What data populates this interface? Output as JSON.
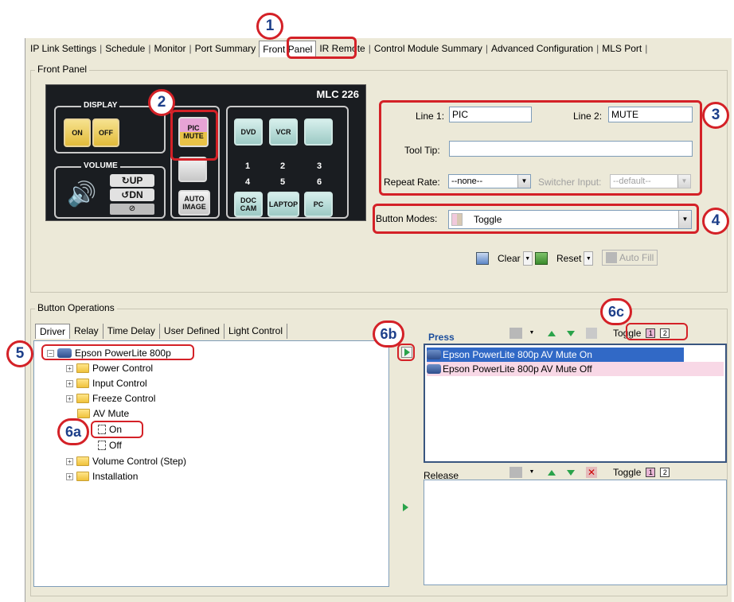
{
  "tabs": [
    {
      "label": "IP Link Settings"
    },
    {
      "label": "Schedule"
    },
    {
      "label": "Monitor"
    },
    {
      "label": "Port Summary"
    },
    {
      "label": "Front Panel",
      "active": true
    },
    {
      "label": "IR Remote"
    },
    {
      "label": "Control Module Summary"
    },
    {
      "label": "Advanced Configuration"
    },
    {
      "label": "MLS Port"
    }
  ],
  "front_panel": {
    "legend": "Front Panel",
    "model": "MLC 226",
    "display_label": "DISPLAY",
    "volume_label": "VOLUME",
    "buttons": {
      "on": "ON",
      "off": "OFF",
      "pic": "PIC",
      "mute": "MUTE",
      "dvd": "DVD",
      "vcr": "VCR",
      "auto": "AUTO",
      "image": "IMAGE",
      "doc": "DOC",
      "cam": "CAM",
      "laptop": "LAPTOP",
      "pc": "PC",
      "up": "UP",
      "dn": "DN"
    },
    "numbers": [
      "1",
      "2",
      "3",
      "4",
      "5",
      "6"
    ]
  },
  "form": {
    "line1_label": "Line 1:",
    "line1_value": "PIC",
    "line2_label": "Line 2:",
    "line2_value": "MUTE",
    "tooltip_label": "Tool Tip:",
    "tooltip_value": "",
    "repeat_label": "Repeat Rate:",
    "repeat_value": "--none--",
    "switcher_label": "Switcher Input:",
    "switcher_value": "--default--",
    "modes_label": "Button Modes:",
    "modes_value": "Toggle",
    "clear_label": "Clear",
    "reset_label": "Reset",
    "autofill_label": "Auto Fill"
  },
  "button_ops": {
    "legend": "Button Operations",
    "subtabs": [
      "Driver",
      "Relay",
      "Time Delay",
      "User Defined",
      "Light Control"
    ],
    "tree": {
      "root": "Epson PowerLite 800p",
      "children": [
        "Power Control",
        "Input Control",
        "Freeze Control",
        "AV Mute"
      ],
      "av_mute_children": [
        "On",
        "Off"
      ],
      "more": [
        "Volume Control (Step)",
        "Installation"
      ]
    },
    "press_label": "Press",
    "release_label": "Release",
    "toggle_label": "Toggle",
    "press_items": [
      "Epson PowerLite 800p AV Mute On",
      "Epson PowerLite 800p AV Mute Off"
    ],
    "page1": "1",
    "page2": "2"
  },
  "callouts": [
    "1",
    "2",
    "3",
    "4",
    "5",
    "6a",
    "6b",
    "6c"
  ],
  "colors": {
    "callout_red": "#d42127",
    "callout_text": "#1d3f8a",
    "window_bg": "#ece9d8"
  }
}
